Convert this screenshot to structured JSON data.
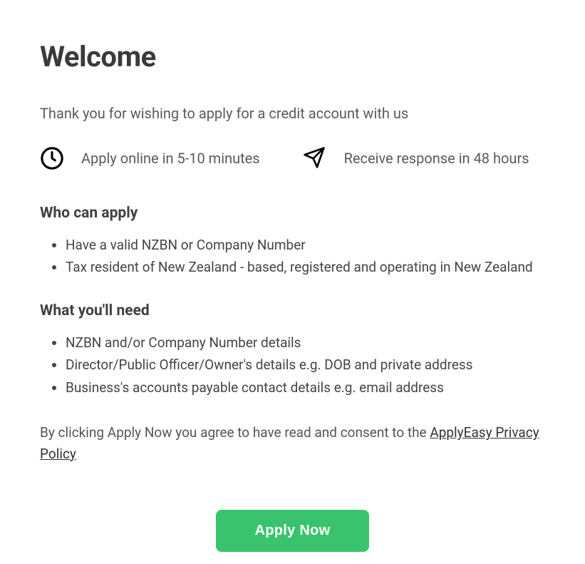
{
  "title": "Welcome",
  "intro": "Thank you for wishing to apply for a credit account with us",
  "highlights": {
    "time": "Apply online in 5-10 minutes",
    "response": "Receive response in 48 hours"
  },
  "who": {
    "heading": "Who can apply",
    "items": [
      "Have a valid NZBN or Company Number",
      "Tax resident of New Zealand - based, registered and operating in New Zealand"
    ]
  },
  "need": {
    "heading": "What you'll need",
    "items": [
      "NZBN and/or Company Number details",
      "Director/Public Officer/Owner's details e.g. DOB and private address",
      "Business's accounts payable contact details e.g. email address"
    ]
  },
  "consent": {
    "prefix": "By clicking Apply Now you agree to have read and consent to the ",
    "link": "ApplyEasy Privacy Policy"
  },
  "cta": {
    "apply_label": "Apply Now"
  }
}
